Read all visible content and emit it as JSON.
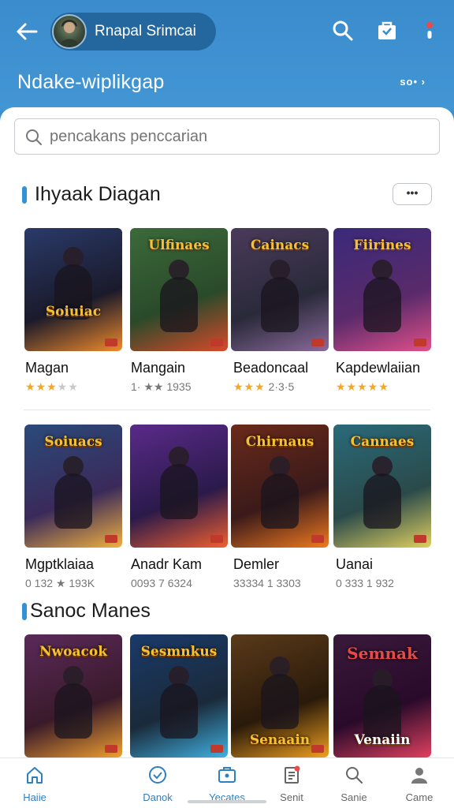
{
  "header": {
    "user_name": "Rnapal Srimcai",
    "title": "Ndake-wiplikgap",
    "more_label": "so• ›"
  },
  "search": {
    "placeholder": "pencakans penccarian"
  },
  "section1": {
    "title": "Ihyaak Diagan",
    "more_label": "•••"
  },
  "row1": [
    {
      "name": "Magan",
      "meta": "",
      "stars": "★★★",
      "stars_off": "★★",
      "logo": "Soiuiac",
      "bg": "#2a3a6a",
      "glow": "#f08a2c"
    },
    {
      "name": "Mangain",
      "meta": "1· ★★ 1935",
      "stars": "",
      "stars_off": "",
      "logo": "Ulfinaes",
      "bg": "#3b6a3a",
      "glow": "#d84a2a"
    },
    {
      "name": "Beadoncaal",
      "meta": "2·3·5",
      "stars": "★★★",
      "stars_off": "",
      "logo": "Cainacs",
      "bg": "#4a3a5a",
      "glow": "#8a6a9a"
    },
    {
      "name": "Kapdewlaiian",
      "meta": "",
      "stars": "★★★★★",
      "stars_off": "",
      "logo": "Fiirines",
      "bg": "#3a2a7a",
      "glow": "#e0508a"
    }
  ],
  "row2": [
    {
      "name": "Mgptklaiaa",
      "meta": "0 132 ★ 193K",
      "logo": "Soiuacs",
      "bg": "#2a4a7a",
      "glow": "#f0b040"
    },
    {
      "name": "Anadr Kam",
      "meta": "0093 7 6324",
      "logo": "",
      "bg": "#5a2a8a",
      "glow": "#f06030"
    },
    {
      "name": "Demler",
      "meta": "33334 1 3303",
      "logo": "Chirnaus",
      "bg": "#6a2a1a",
      "glow": "#f07a20"
    },
    {
      "name": "Uanai",
      "meta": "0 333 1 932",
      "logo": "Cannaes",
      "bg": "#2a6a7a",
      "glow": "#e0d060"
    }
  ],
  "section2": {
    "title": "Sanoc Manes"
  },
  "row3": [
    {
      "logo": "Nwoacok",
      "bottom": "",
      "bg": "#5a2a5a",
      "glow": "#f0a030"
    },
    {
      "logo": "Sesmnkus",
      "bottom": "",
      "bg": "#1a3a6a",
      "glow": "#40b0e0"
    },
    {
      "logo": "",
      "bottom": "Senaain",
      "bg": "#5a3a1a",
      "glow": "#f0a020"
    },
    {
      "logo": "Semnak",
      "bottom": "Venaiin",
      "bg": "#3a1a3a",
      "glow": "#e04060"
    }
  ],
  "nav": [
    {
      "label": "Haiie",
      "icon": "home-icon"
    },
    {
      "label": "Danok",
      "icon": "check-circle-icon"
    },
    {
      "label": "Yecates",
      "icon": "briefcase-icon"
    },
    {
      "label": "Senit",
      "icon": "document-icon"
    },
    {
      "label": "Sanie",
      "icon": "search-icon"
    },
    {
      "label": "Came",
      "icon": "profile-icon"
    }
  ],
  "colors": {
    "accent": "#3392d6",
    "header": "#3a8ccc",
    "nav_active": "#2f7fc1",
    "star": "#f5a623"
  }
}
